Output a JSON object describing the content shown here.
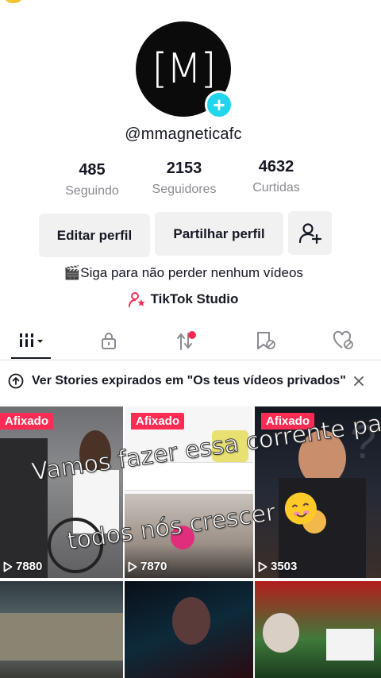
{
  "profile": {
    "avatar_text": "[M]",
    "username": "@mmagneticafc",
    "stats": [
      {
        "value": "485",
        "label": "Seguindo"
      },
      {
        "value": "2153",
        "label": "Seguidores"
      },
      {
        "value": "4632",
        "label": "Curtidas"
      }
    ],
    "buttons": {
      "edit": "Editar perfil",
      "share": "Partilhar perfil"
    },
    "bio": "🎬Siga para não perder nenhum vídeos",
    "studio": "TikTok Studio"
  },
  "stories_bar": {
    "text": "Ver Stories expirados em \"Os teus vídeos privados\""
  },
  "grid": {
    "items": [
      {
        "badge": "Afixado",
        "views": "7880"
      },
      {
        "badge": "Afixado",
        "views": "7870"
      },
      {
        "badge": "Afixado",
        "views": "3503"
      },
      {
        "badge": "",
        "views": ""
      },
      {
        "badge": "",
        "views": ""
      },
      {
        "badge": "",
        "views": ""
      }
    ],
    "overlay_line1": "Vamos fazer essa corrente para",
    "overlay_line2": "todos nós crescer"
  },
  "colors": {
    "accent_cyan": "#20d5ec",
    "badge_red": "#fe2c55",
    "text_primary": "#161823",
    "text_secondary": "#8a8b91"
  }
}
